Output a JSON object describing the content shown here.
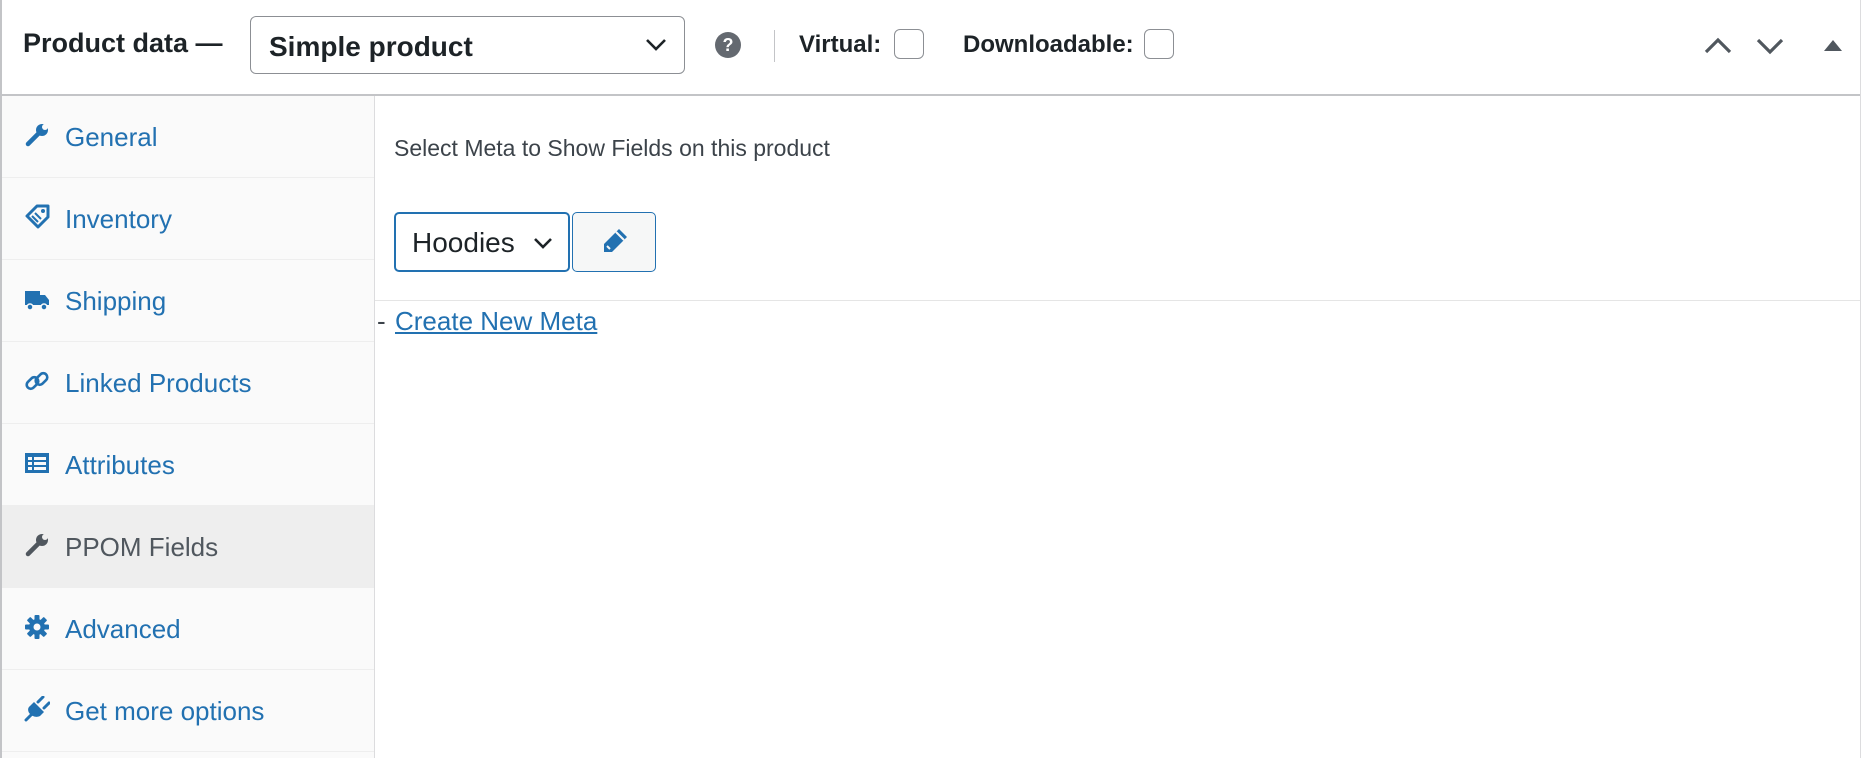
{
  "header": {
    "title": "Product data —",
    "product_type": "Simple product",
    "help_icon": "help-icon",
    "virtual_label": "Virtual:",
    "downloadable_label": "Downloadable:",
    "virtual_checked": false,
    "downloadable_checked": false
  },
  "tabs": [
    {
      "label": "General",
      "icon": "wrench-icon",
      "active": false
    },
    {
      "label": "Inventory",
      "icon": "tag-icon",
      "active": false
    },
    {
      "label": "Shipping",
      "icon": "truck-icon",
      "active": false
    },
    {
      "label": "Linked Products",
      "icon": "link-icon",
      "active": false
    },
    {
      "label": "Attributes",
      "icon": "list-table-icon",
      "active": false
    },
    {
      "label": "PPOM Fields",
      "icon": "wrench-icon",
      "active": true
    },
    {
      "label": "Advanced",
      "icon": "gear-icon",
      "active": false
    },
    {
      "label": "Get more options",
      "icon": "plugin-icon",
      "active": false
    }
  ],
  "main": {
    "meta_label": "Select Meta to Show Fields on this product",
    "meta_selected": "Hoodies",
    "edit_icon": "pencil-icon",
    "create_prefix": "-",
    "create_link": "Create New Meta"
  },
  "colors": {
    "link": "#2271b1",
    "border": "#c3c4c7",
    "sidebar_bg": "#fafafa",
    "active_tab_bg": "#eeeeee"
  }
}
